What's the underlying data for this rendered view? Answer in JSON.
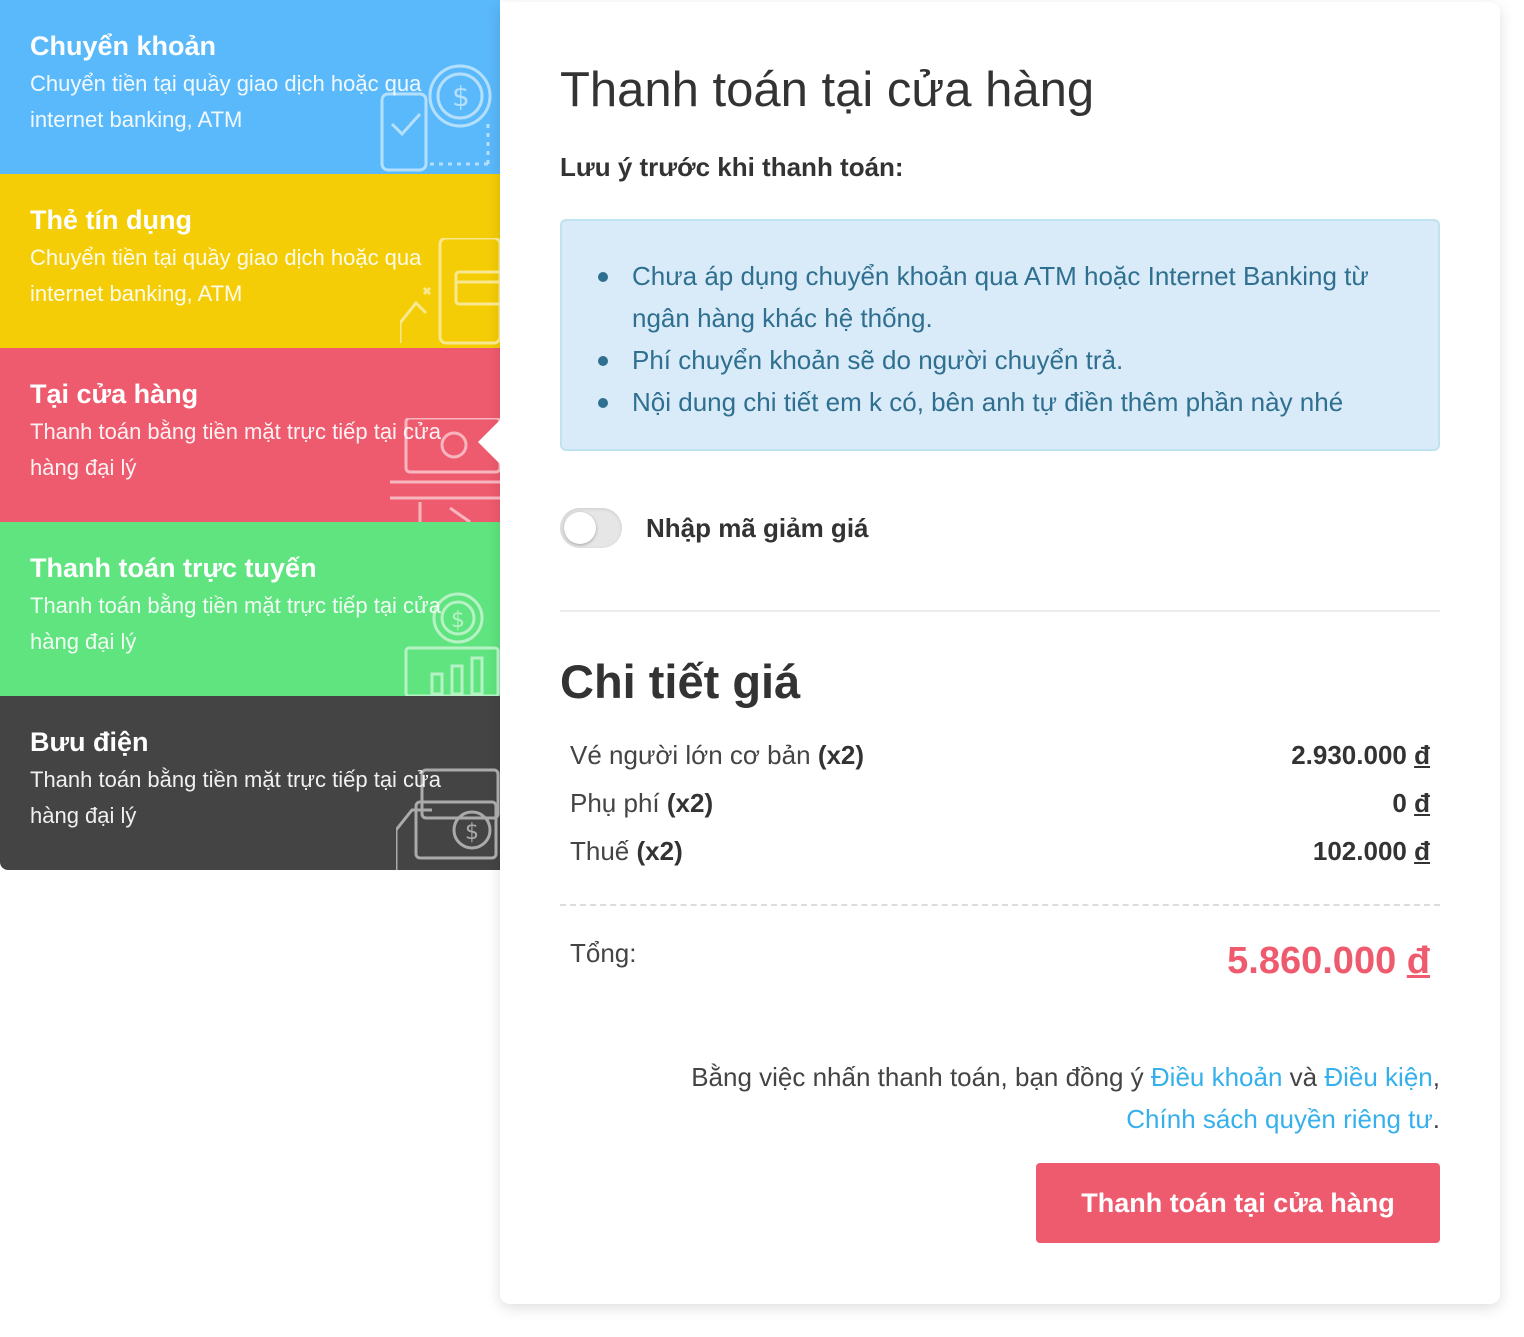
{
  "methods": [
    {
      "title": "Chuyển khoản",
      "desc": "Chuyển tiền tại quầy giao dịch hoặc qua internet banking, ATM",
      "color": "#5ab9fb",
      "icon": "mobile-payment-icon"
    },
    {
      "title": "Thẻ tín dụng",
      "desc": "Chuyển tiền tại quầy giao dịch hoặc qua internet banking, ATM",
      "color": "#f4cd06",
      "icon": "credit-card-icon"
    },
    {
      "title": "Tại cửa hàng",
      "desc": "Thanh toán bằng tiền mặt trực tiếp tại cửa hàng đại lý",
      "color": "#ef5b6e",
      "icon": "cash-hand-icon",
      "active": true
    },
    {
      "title": "Thanh toán trực tuyến",
      "desc": "Thanh toán bằng tiền mặt trực tiếp tại cửa hàng đại lý",
      "color": "#5fe47f",
      "icon": "online-chart-icon"
    },
    {
      "title": "Bưu điện",
      "desc": "Thanh toán bằng tiền mặt trực tiếp tại cửa hàng đại lý",
      "color": "#444444",
      "icon": "wallet-coin-icon"
    }
  ],
  "main": {
    "title": "Thanh toán tại cửa hàng",
    "note_title": "Lưu ý trước khi thanh toán:",
    "notes": [
      "Chưa áp dụng chuyển khoản qua ATM hoặc Internet Banking từ ngân hàng khác hệ thống.",
      "Phí chuyển khoản sẽ do người chuyển trả.",
      "Nội dung chi tiết em k có, bên anh tự điền thêm phần này nhé"
    ],
    "discount_toggle_label": "Nhập mã giảm giá",
    "discount_toggle_on": false
  },
  "price": {
    "title": "Chi tiết giá",
    "rows": [
      {
        "label": "Vé người lớn cơ bản",
        "qty": "(x2)",
        "amount": "2.930.000",
        "currency": "đ"
      },
      {
        "label": "Phụ phí",
        "qty": "(x2)",
        "amount": "0",
        "currency": "đ"
      },
      {
        "label": "Thuế",
        "qty": "(x2)",
        "amount": "102.000",
        "currency": "đ"
      }
    ],
    "total_label": "Tổng:",
    "total_amount": "5.860.000",
    "total_currency": "đ"
  },
  "terms": {
    "prefix": "Bằng việc nhấn thanh toán, bạn đồng ý ",
    "link1": "Điều khoản",
    "mid": " và ",
    "link2": "Điều kiện",
    "comma": ",",
    "link3": "Chính sách quyền riêng tư",
    "end": "."
  },
  "pay_button": "Thanh toán tại cửa hàng",
  "colors": {
    "accent": "#ef5b6e",
    "link": "#35b0ec",
    "alert_bg": "#d9ebf8",
    "alert_text": "#2f6f8f"
  }
}
